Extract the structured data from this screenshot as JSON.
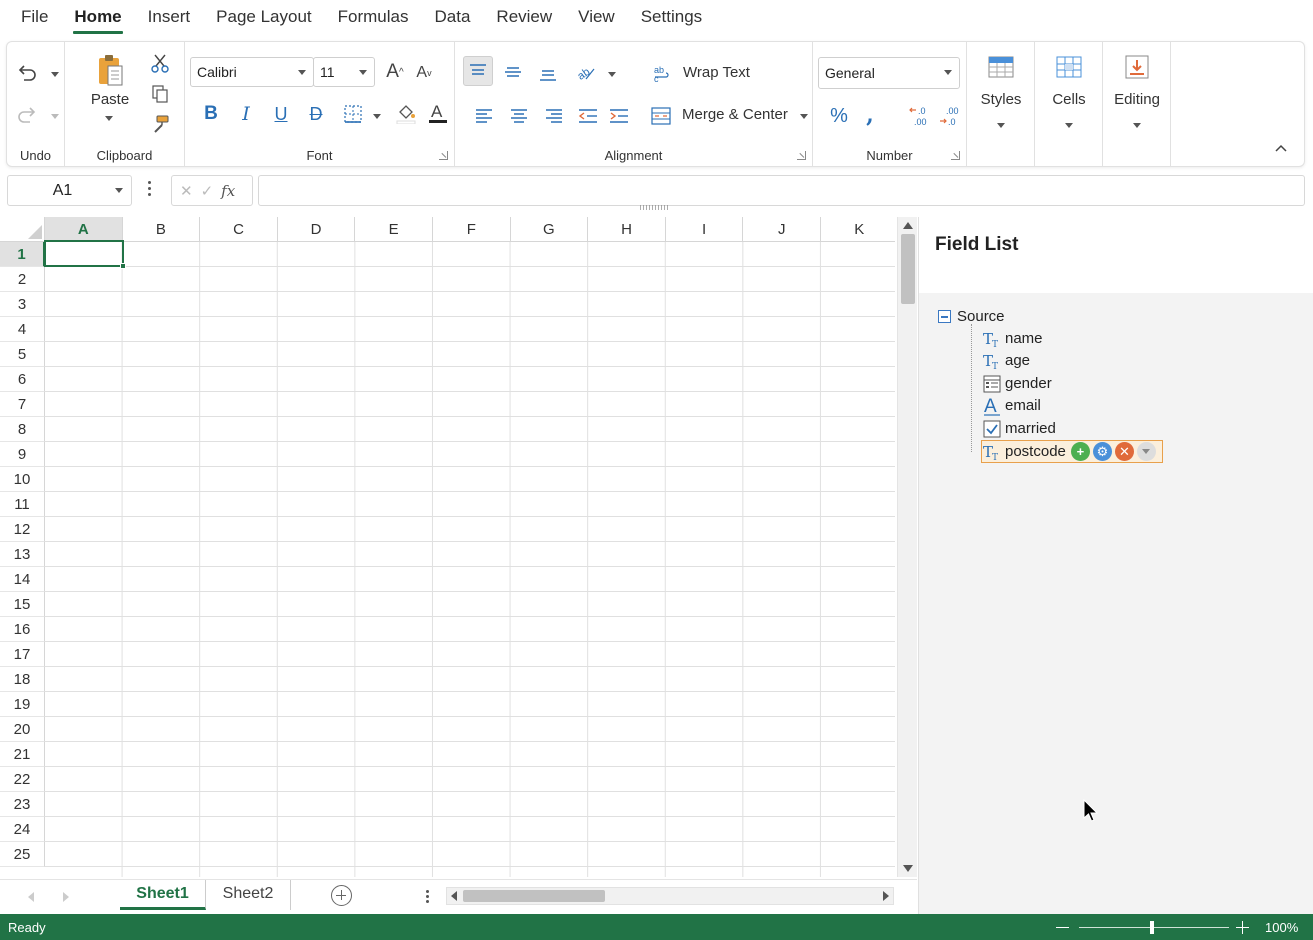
{
  "menu": {
    "items": [
      {
        "label": "File"
      },
      {
        "label": "Home"
      },
      {
        "label": "Insert"
      },
      {
        "label": "Page Layout"
      },
      {
        "label": "Formulas"
      },
      {
        "label": "Data"
      },
      {
        "label": "Review"
      },
      {
        "label": "View"
      },
      {
        "label": "Settings"
      }
    ],
    "active": "Home"
  },
  "ribbon": {
    "groups": {
      "undo": "Undo",
      "clipboard": "Clipboard",
      "font": "Font",
      "alignment": "Alignment",
      "number": "Number"
    },
    "paste_label": "Paste",
    "font_name": "Calibri",
    "font_size": "11",
    "wrap_text": "Wrap Text",
    "merge_center": "Merge & Center",
    "number_format": "General",
    "styles": "Styles",
    "cells": "Cells",
    "editing": "Editing"
  },
  "formula_bar": {
    "name_box": "A1",
    "fx": "fx",
    "value": ""
  },
  "grid": {
    "columns": [
      "A",
      "B",
      "C",
      "D",
      "E",
      "F",
      "G",
      "H",
      "I",
      "J",
      "K"
    ],
    "rows": [
      "1",
      "2",
      "3",
      "4",
      "5",
      "6",
      "7",
      "8",
      "9",
      "10",
      "11",
      "12",
      "13",
      "14",
      "15",
      "16",
      "17",
      "18",
      "19",
      "20",
      "21",
      "22",
      "23",
      "24",
      "25"
    ],
    "selected_cell": "A1"
  },
  "sheets": {
    "tabs": [
      "Sheet1",
      "Sheet2"
    ],
    "active": "Sheet1"
  },
  "field_list": {
    "title": "Field List",
    "root": "Source",
    "fields": [
      {
        "name": "name",
        "icon": "text-type-icon"
      },
      {
        "name": "age",
        "icon": "text-type-icon"
      },
      {
        "name": "gender",
        "icon": "list-type-icon"
      },
      {
        "name": "email",
        "icon": "letter-a-icon"
      },
      {
        "name": "married",
        "icon": "checkbox-type-icon"
      },
      {
        "name": "postcode",
        "icon": "text-type-icon",
        "selected": true
      }
    ]
  },
  "status": {
    "text": "Ready",
    "zoom": "100%"
  },
  "colors": {
    "accent": "#217346",
    "selection_border": "#e8a04b"
  }
}
